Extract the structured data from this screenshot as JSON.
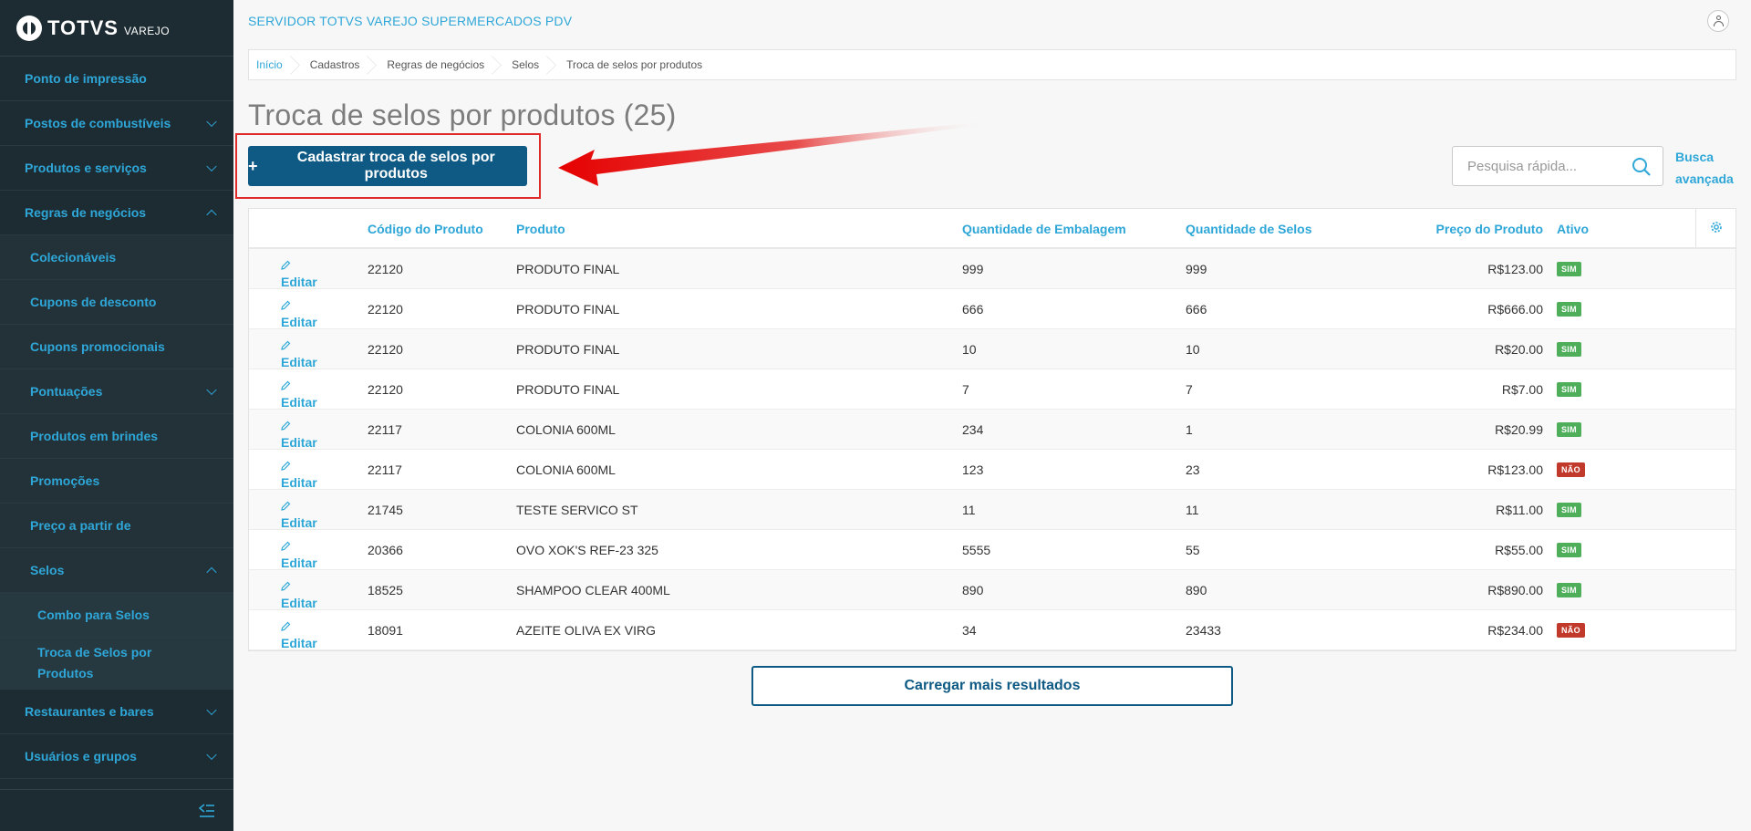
{
  "brand": {
    "name": "TOTVS",
    "product": "VAREJO"
  },
  "header": {
    "server_title": "SERVIDOR TOTVS VAREJO SUPERMERCADOS PDV"
  },
  "sidebar": {
    "items": [
      {
        "label": "Ponto de impressão",
        "level": 0,
        "chevron": "none"
      },
      {
        "label": "Postos de combustíveis",
        "level": 0,
        "chevron": "down"
      },
      {
        "label": "Produtos e serviços",
        "level": 0,
        "chevron": "down"
      },
      {
        "label": "Regras de negócios",
        "level": 0,
        "chevron": "up"
      },
      {
        "label": "Colecionáveis",
        "level": 1,
        "chevron": "none"
      },
      {
        "label": "Cupons de desconto",
        "level": 1,
        "chevron": "none"
      },
      {
        "label": "Cupons promocionais",
        "level": 1,
        "chevron": "none"
      },
      {
        "label": "Pontuações",
        "level": 1,
        "chevron": "down"
      },
      {
        "label": "Produtos em brindes",
        "level": 1,
        "chevron": "none"
      },
      {
        "label": "Promoções",
        "level": 1,
        "chevron": "none"
      },
      {
        "label": "Preço a partir de",
        "level": 1,
        "chevron": "none"
      },
      {
        "label": "Selos",
        "level": 1,
        "chevron": "up"
      },
      {
        "label": "Combo para Selos",
        "level": 2,
        "chevron": "none"
      },
      {
        "label": "Troca de Selos por Produtos",
        "level": 2,
        "chevron": "none"
      },
      {
        "label": "Restaurantes e bares",
        "level": 0,
        "chevron": "down"
      },
      {
        "label": "Usuários e grupos",
        "level": 0,
        "chevron": "down"
      }
    ]
  },
  "breadcrumb": [
    "Início",
    "Cadastros",
    "Regras de negócios",
    "Selos",
    "Troca de selos por produtos"
  ],
  "page": {
    "title": "Troca de selos por produtos (25)",
    "primary_button": "Cadastrar troca de selos por produtos",
    "search_placeholder": "Pesquisa rápida...",
    "advanced_search": "Busca avançada",
    "load_more": "Carregar mais resultados"
  },
  "table": {
    "edit_label": "Editar",
    "columns": [
      "Código do Produto",
      "Produto",
      "Quantidade de Embalagem",
      "Quantidade de Selos",
      "Preço do Produto",
      "Ativo"
    ],
    "rows": [
      {
        "codigo": "22120",
        "produto": "PRODUTO FINAL",
        "embalagem": "999",
        "selos": "999",
        "preco": "R$123.00",
        "ativo": "SIM"
      },
      {
        "codigo": "22120",
        "produto": "PRODUTO FINAL",
        "embalagem": "666",
        "selos": "666",
        "preco": "R$666.00",
        "ativo": "SIM"
      },
      {
        "codigo": "22120",
        "produto": "PRODUTO FINAL",
        "embalagem": "10",
        "selos": "10",
        "preco": "R$20.00",
        "ativo": "SIM"
      },
      {
        "codigo": "22120",
        "produto": "PRODUTO FINAL",
        "embalagem": "7",
        "selos": "7",
        "preco": "R$7.00",
        "ativo": "SIM"
      },
      {
        "codigo": "22117",
        "produto": "COLONIA 600ML",
        "embalagem": "234",
        "selos": "1",
        "preco": "R$20.99",
        "ativo": "SIM"
      },
      {
        "codigo": "22117",
        "produto": "COLONIA 600ML",
        "embalagem": "123",
        "selos": "23",
        "preco": "R$123.00",
        "ativo": "NÃO"
      },
      {
        "codigo": "21745",
        "produto": "TESTE SERVICO ST",
        "embalagem": "11",
        "selos": "11",
        "preco": "R$11.00",
        "ativo": "SIM"
      },
      {
        "codigo": "20366",
        "produto": "OVO XOK'S REF-23 325",
        "embalagem": "5555",
        "selos": "55",
        "preco": "R$55.00",
        "ativo": "SIM"
      },
      {
        "codigo": "18525",
        "produto": "SHAMPOO CLEAR 400ML",
        "embalagem": "890",
        "selos": "890",
        "preco": "R$890.00",
        "ativo": "SIM"
      },
      {
        "codigo": "18091",
        "produto": "AZEITE OLIVA EX VIRG",
        "embalagem": "34",
        "selos": "23433",
        "preco": "R$234.00",
        "ativo": "NÃO"
      }
    ]
  },
  "colors": {
    "sidebar_bg": "#1d2c33",
    "accent": "#2ea7d8",
    "primary": "#0f5a84",
    "badge_yes": "#4fae5a",
    "badge_no": "#c0392b",
    "annotation": "#e02a2a"
  },
  "icons": [
    "totvs-logo-icon",
    "user-icon",
    "chevron-down-icon",
    "chevron-up-icon",
    "collapse-menu-icon",
    "search-icon",
    "gear-icon",
    "pencil-icon",
    "red-arrow-annotation"
  ]
}
